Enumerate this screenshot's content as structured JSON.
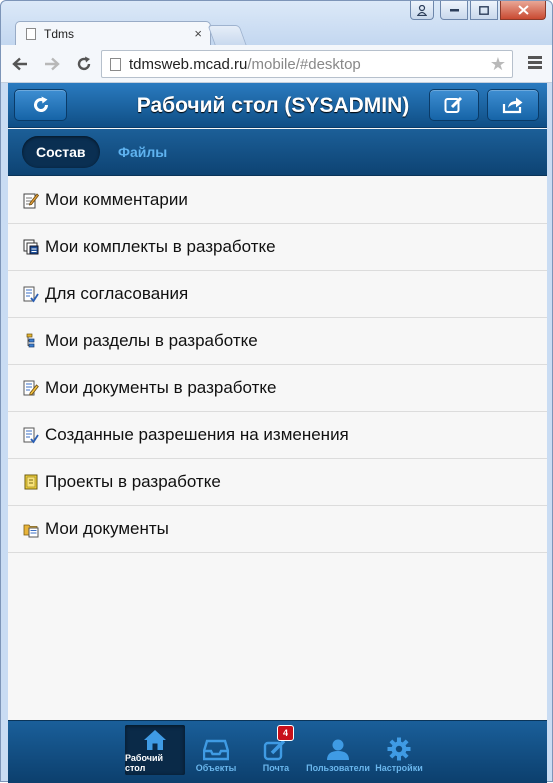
{
  "browser": {
    "tab_title": "Tdms",
    "tab_close": "×",
    "url_domain": "tdmsweb.mcad.ru",
    "url_path": "/mobile/#desktop"
  },
  "header": {
    "title": "Рабочий стол (SYSADMIN)"
  },
  "subnav": {
    "tabs": [
      {
        "label": "Состав",
        "active": true
      },
      {
        "label": "Файлы",
        "active": false
      }
    ]
  },
  "list": {
    "items": [
      {
        "label": "Мои комментарии",
        "icon": "comment-edit-icon"
      },
      {
        "label": "Мои комплекты в разработке",
        "icon": "document-set-icon"
      },
      {
        "label": "Для согласования",
        "icon": "approval-document-icon"
      },
      {
        "label": "Мои разделы в разработке",
        "icon": "section-tree-icon"
      },
      {
        "label": "Мои документы в разработке",
        "icon": "document-edit-icon"
      },
      {
        "label": "Созданные разрешения на изменения",
        "icon": "change-permit-icon"
      },
      {
        "label": "Проекты в разработке",
        "icon": "project-folder-icon"
      },
      {
        "label": "Мои документы",
        "icon": "documents-icon"
      }
    ]
  },
  "footer": {
    "buttons": [
      {
        "label": "Рабочий стол",
        "icon": "home-icon",
        "active": true
      },
      {
        "label": "Объекты",
        "icon": "inbox-icon",
        "active": false
      },
      {
        "label": "Почта",
        "icon": "compose-icon",
        "active": false,
        "badge": "4"
      },
      {
        "label": "Пользователи",
        "icon": "user-icon",
        "active": false
      },
      {
        "label": "Настройки",
        "icon": "gear-icon",
        "active": false
      }
    ]
  },
  "colors": {
    "header_blue": "#1664a7",
    "badge_red": "#c8101a",
    "inactive_tab": "#5fb3f0"
  }
}
